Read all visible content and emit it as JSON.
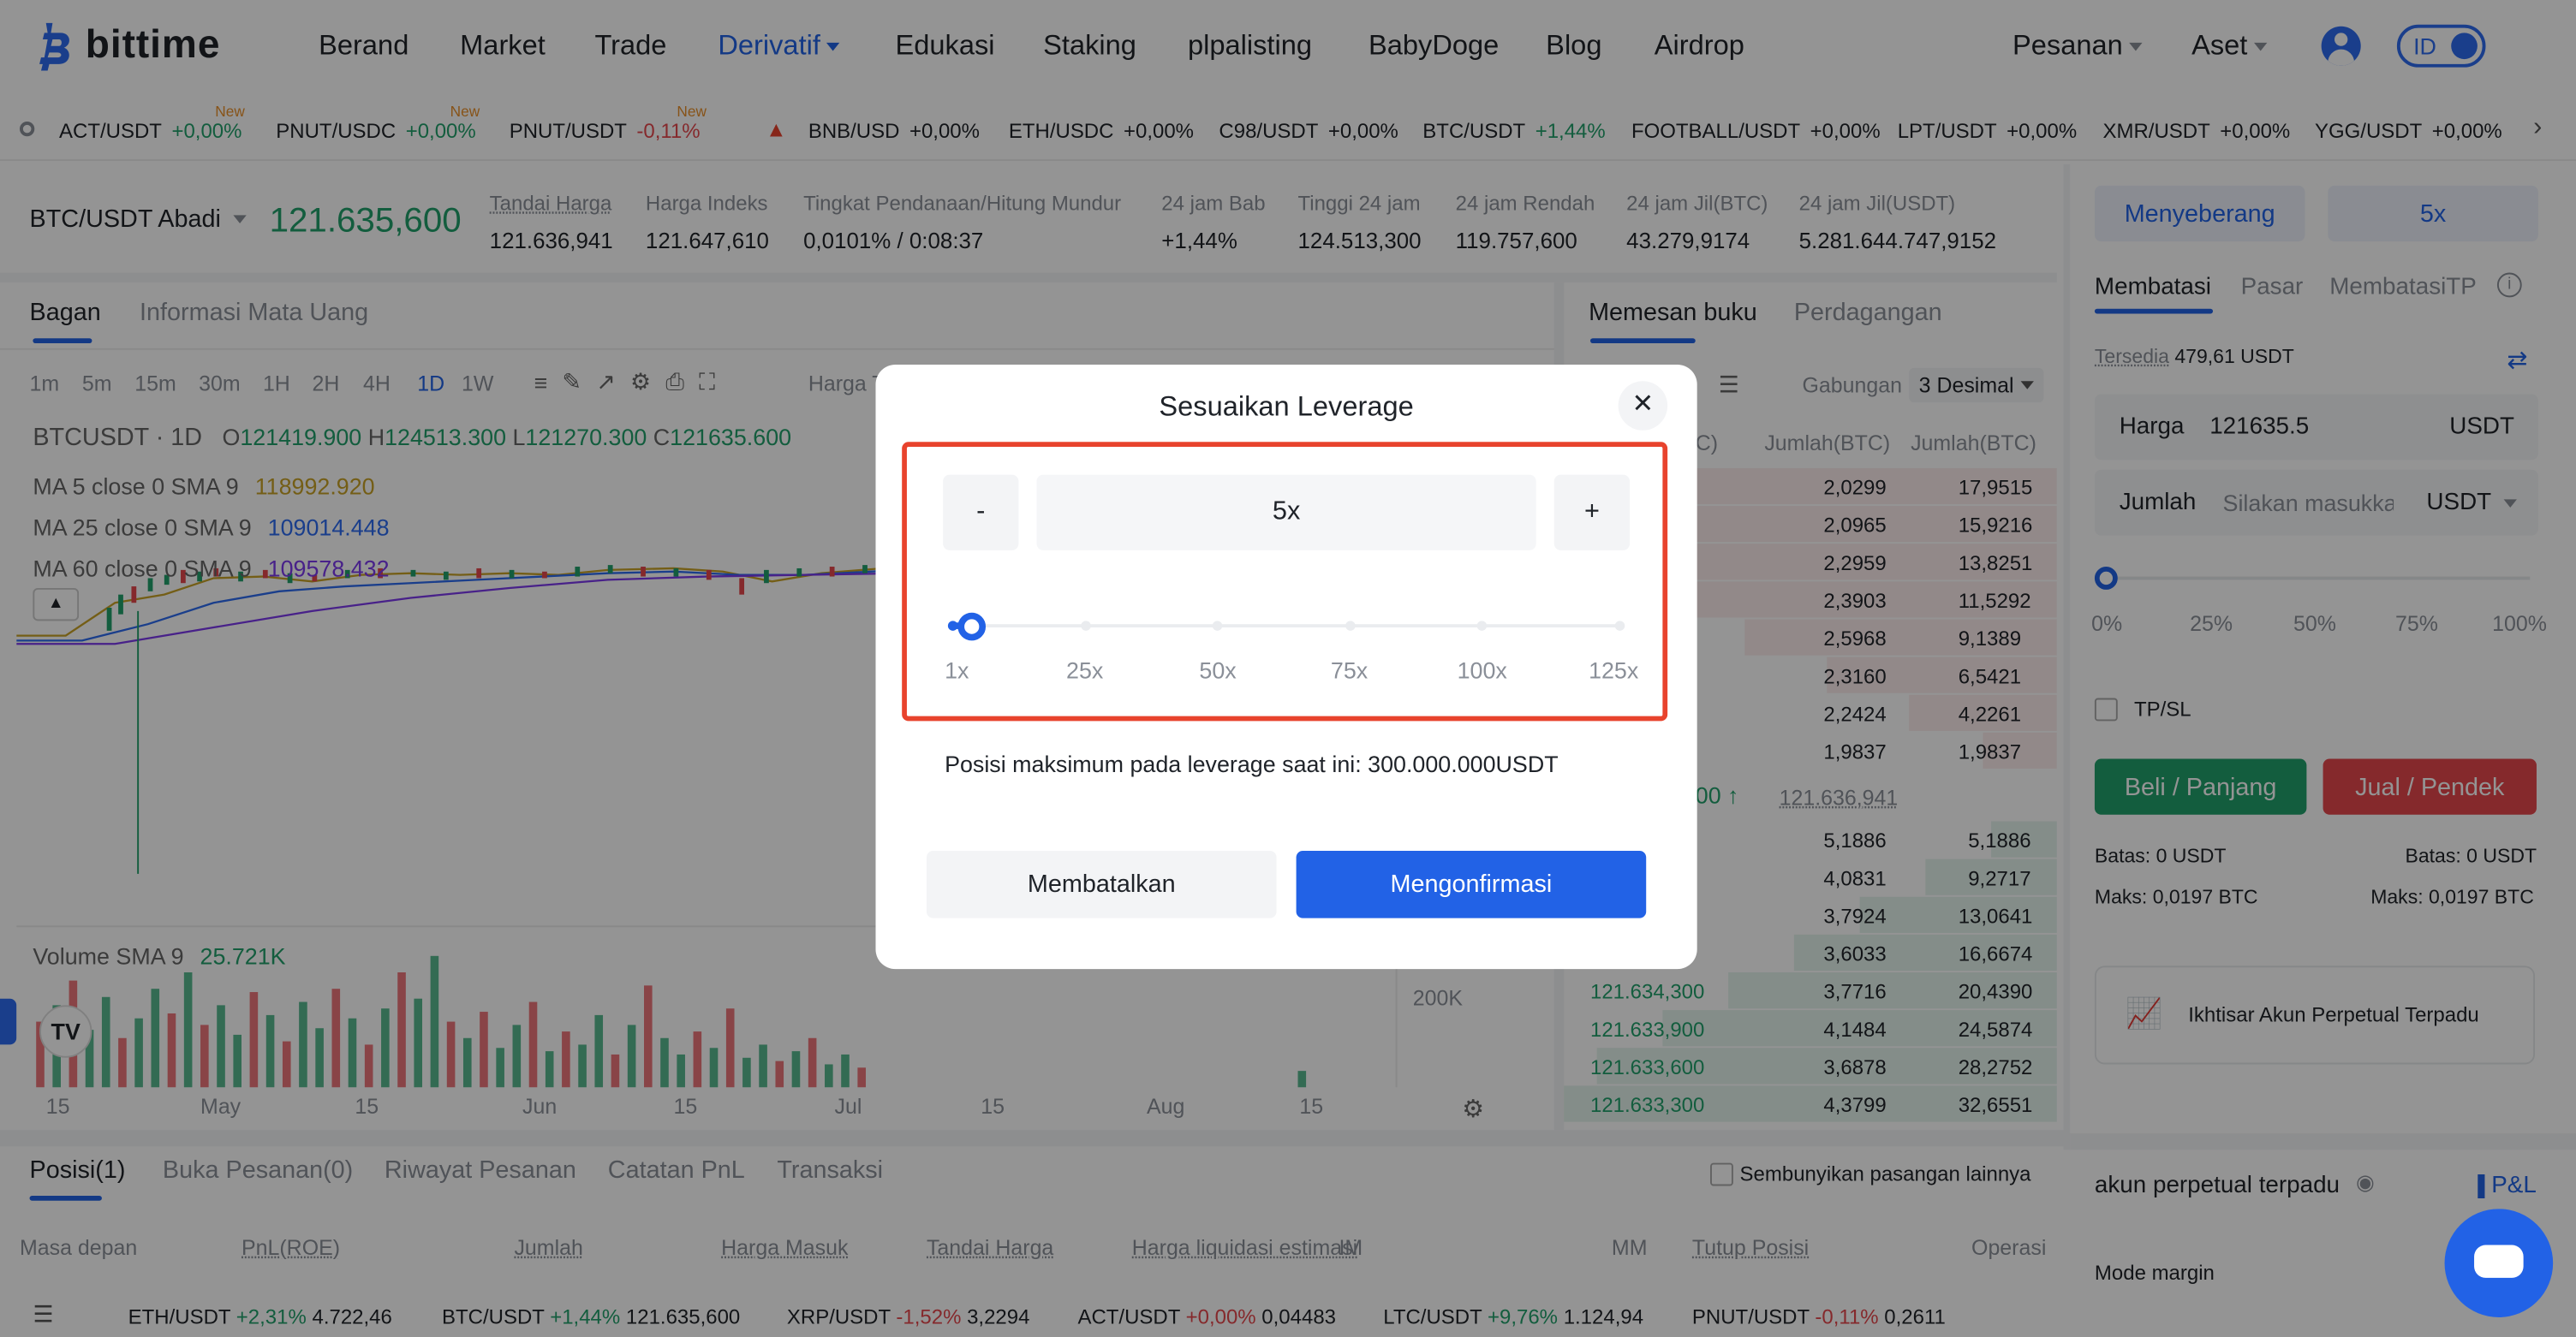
{
  "nav": {
    "brand": "bittime",
    "items": [
      "Berand",
      "Market",
      "Trade",
      "Derivatif",
      "Edukasi",
      "Staking",
      "plpalisting",
      "BabyDoge",
      "Blog",
      "Airdrop"
    ],
    "active": "Derivatif",
    "pesanan": "Pesanan",
    "aset": "Aset",
    "lang": "ID"
  },
  "ticker": [
    {
      "pair": "ACT/USDT",
      "chg": "+0,00%",
      "dir": "up",
      "new": "New"
    },
    {
      "pair": "PNUT/USDC",
      "chg": "+0,00%",
      "dir": "up",
      "new": "New"
    },
    {
      "pair": "PNUT/USDT",
      "chg": "-0,11%",
      "dir": "down",
      "new": "New"
    },
    {
      "pair": "BNB/USD",
      "chg": "+0,00%",
      "dir": "flat",
      "fire": true
    },
    {
      "pair": "ETH/USDC",
      "chg": "+0,00%",
      "dir": "flat"
    },
    {
      "pair": "C98/USDT",
      "chg": "+0,00%",
      "dir": "flat"
    },
    {
      "pair": "BTC/USDT",
      "chg": "+1,44%",
      "dir": "up"
    },
    {
      "pair": "FOOTBALL/USDT",
      "chg": "+0,00%",
      "dir": "flat"
    },
    {
      "pair": "LPT/USDT",
      "chg": "+0,00%",
      "dir": "flat"
    },
    {
      "pair": "XMR/USDT",
      "chg": "+0,00%",
      "dir": "flat"
    },
    {
      "pair": "YGG/USDT",
      "chg": "+0,00%",
      "dir": "flat"
    }
  ],
  "market": {
    "symbol": "BTC/USDT Abadi",
    "last_price": "121.635,600",
    "stats": [
      {
        "label": "Tandai Harga",
        "value": "121.636,941",
        "color": "red"
      },
      {
        "label": "Harga Indeks",
        "value": "121.647,610",
        "color": "red"
      },
      {
        "label": "Tingkat Pendanaan/Hitung Mundur",
        "value": "0,0101% / 0:08:37",
        "color": "dark"
      },
      {
        "label": "24 jam Bab",
        "value": "+1,44%",
        "color": "green"
      },
      {
        "label": "Tinggi 24 jam",
        "value": "124.513,300",
        "color": "dark"
      },
      {
        "label": "24 jam Rendah",
        "value": "119.757,600",
        "color": "dark"
      },
      {
        "label": "24 jam Jil(BTC)",
        "value": "43.279,9174",
        "color": "dark"
      },
      {
        "label": "24 jam Jil(USDT)",
        "value": "5.281.644.747,9152",
        "color": "dark"
      }
    ]
  },
  "chart_panel": {
    "tabs": [
      "Bagan",
      "Informasi Mata Uang"
    ],
    "intervals": [
      "1m",
      "5m",
      "15m",
      "30m",
      "1H",
      "2H",
      "4H",
      "1D",
      "1W"
    ],
    "active_interval": "1D",
    "harga": "Harga T",
    "legend_title": "BTCUSDT · 1D",
    "ohlc": {
      "o": "121419.900",
      "h": "124513.300",
      "l": "121270.300",
      "c": "121635.600"
    },
    "ma": [
      {
        "label": "MA 5 close 0 SMA 9",
        "value": "118992.920",
        "color": "#c9a227"
      },
      {
        "label": "MA 25 close 0 SMA 9",
        "value": "109014.448",
        "color": "#2d6cf0"
      },
      {
        "label": "MA 60 close 0 SMA 9",
        "value": "109578.432",
        "color": "#7c3aed"
      }
    ],
    "volume_label": "Volume SMA 9",
    "volume_value": "25.721K",
    "vol_axis": "200K",
    "xaxis": [
      "15",
      "May",
      "15",
      "Jun",
      "15",
      "Jul",
      "15",
      "Aug",
      "15"
    ]
  },
  "orderbook": {
    "tabs": [
      "Memesan buku",
      "Perdagangan"
    ],
    "gabungan": "Gabungan",
    "decimal": "3 Desimal",
    "col_headers": [
      "Jumlah(BTC)",
      "Jumlah(BTC)"
    ],
    "col_partial": "C)",
    "asks": [
      [
        "2,0299",
        "17,9515"
      ],
      [
        "2,0965",
        "15,9216"
      ],
      [
        "2,2959",
        "13,8251"
      ],
      [
        "2,3903",
        "11,5292"
      ],
      [
        "2,5968",
        "9,1389"
      ],
      [
        "2,3160",
        "6,5421"
      ],
      [
        "2,2424",
        "4,2261"
      ],
      [
        "1,9837",
        "1,9837"
      ]
    ],
    "mid_partial": "00",
    "mid_mark": "121.636,941",
    "bids": [
      [
        "",
        "5,1886",
        "5,1886"
      ],
      [
        "",
        "4,0831",
        "9,2717"
      ],
      [
        "",
        "3,7924",
        "13,0641"
      ],
      [
        "",
        "3,6033",
        "16,6674"
      ],
      [
        "121.634,300",
        "3,7716",
        "20,4390"
      ],
      [
        "121.633,900",
        "4,1484",
        "24,5874"
      ],
      [
        "121.633,600",
        "3,6878",
        "28,2752"
      ],
      [
        "121.633,300",
        "4,3799",
        "32,6551"
      ]
    ]
  },
  "order_form": {
    "margin_mode": "Menyeberang",
    "leverage": "5x",
    "tabs": [
      "Membatasi",
      "Pasar",
      "MembatasiTP"
    ],
    "tersedia_label": "Tersedia",
    "tersedia_value": "479,61 USDT",
    "harga_label": "Harga",
    "harga_value": "121635.5",
    "harga_unit": "USDT",
    "jumlah_label": "Jumlah",
    "jumlah_placeholder": "Silakan masukkan",
    "jumlah_unit": "USDT",
    "pct": [
      "0%",
      "25%",
      "50%",
      "75%",
      "100%"
    ],
    "tpsl": "TP/SL",
    "buy": "Beli / Panjang",
    "sell": "Jual / Pendek",
    "batas_l": "Batas: 0 USDT",
    "batas_r": "Batas: 0 USDT",
    "maks_l": "Maks: 0,0197 BTC",
    "maks_r": "Maks: 0,0197 BTC",
    "promo": "Ikhtisar Akun Perpetual Terpadu",
    "account_title": "akun perpetual terpadu",
    "pnl": "P&L",
    "mode_margin": "Mode margin",
    "mode_partial": "Ma"
  },
  "positions": {
    "tabs": [
      "Posisi(1)",
      "Buka Pesanan(0)",
      "Riwayat Pesanan",
      "Catatan PnL",
      "Transaksi"
    ],
    "hide_other": "Sembunyikan pasangan lainnya",
    "columns": [
      "Masa depan",
      "PnL(ROE)",
      "Jumlah",
      "Harga Masuk",
      "Tandai Harga",
      "Harga liquidasi estimasi",
      "IM",
      "MM",
      "Tutup Posisi",
      "Operasi"
    ]
  },
  "bottom_ticker": [
    {
      "pair": "ETH/USDT",
      "chg": "+2,31%",
      "dir": "up",
      "price": "4.722,46"
    },
    {
      "pair": "BTC/USDT",
      "chg": "+1,44%",
      "dir": "up",
      "price": "121.635,600"
    },
    {
      "pair": "XRP/USDT",
      "chg": "-1,52%",
      "dir": "down",
      "price": "3,2294"
    },
    {
      "pair": "ACT/USDT",
      "chg": "+0,00%",
      "dir": "down",
      "price": "0,04483"
    },
    {
      "pair": "LTC/USDT",
      "chg": "+9,76%",
      "dir": "up",
      "price": "1.124,94"
    },
    {
      "pair": "PNUT/USDT",
      "chg": "-0,11%",
      "dir": "down",
      "price": "0,2611"
    }
  ],
  "modal": {
    "title": "Sesuaikan Leverage",
    "minus": "-",
    "plus": "+",
    "value": "5x",
    "slider_value": 5,
    "slider_max": 125,
    "marks": [
      "1x",
      "25x",
      "50x",
      "75x",
      "100x",
      "125x"
    ],
    "max_position": "Posisi maksimum pada leverage saat ini: 300.000.000USDT",
    "cancel": "Membatalkan",
    "confirm": "Mengonfirmasi"
  },
  "colors": {
    "accent": "#2262e6",
    "buy": "#22a06b",
    "sell": "#e5484d",
    "highlight": "#e8432d"
  }
}
